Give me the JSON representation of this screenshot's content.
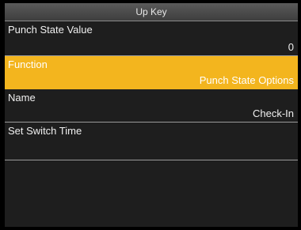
{
  "header": {
    "title": "Up Key"
  },
  "fields": [
    {
      "label": "Punch State Value",
      "value": "0"
    },
    {
      "label": "Function",
      "value": "Punch State Options"
    },
    {
      "label": "Name",
      "value": "Check-In"
    },
    {
      "label": "Set Switch Time",
      "value": ""
    }
  ],
  "colors": {
    "selected_row": "#f3b51e",
    "background": "#1e1e1e"
  }
}
